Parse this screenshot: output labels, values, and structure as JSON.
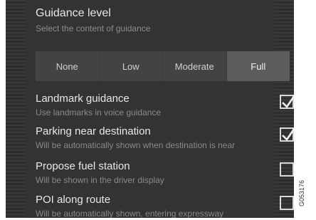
{
  "guidance": {
    "title": "Guidance level",
    "subtitle": "Select the content of guidance",
    "options": [
      "None",
      "Low",
      "Moderate",
      "Full"
    ],
    "selected": "Full"
  },
  "settings": [
    {
      "title": "Landmark guidance",
      "subtitle": "Use landmarks in voice guidance",
      "checked": true
    },
    {
      "title": "Parking near destination",
      "subtitle": "Will be automatically shown when destination is near",
      "checked": true
    },
    {
      "title": "Propose fuel station",
      "subtitle": "Will be shown in the driver display",
      "checked": false
    },
    {
      "title": "POI along route",
      "subtitle": "Will be automatically shown, entering expressway",
      "checked": false
    }
  ],
  "reference_code": "G053176",
  "colors": {
    "background": "#303030",
    "segment": "#434343",
    "segment_active": "#5c5c5c",
    "text": "#e8e8e8",
    "subtext": "#8a8a8a"
  }
}
